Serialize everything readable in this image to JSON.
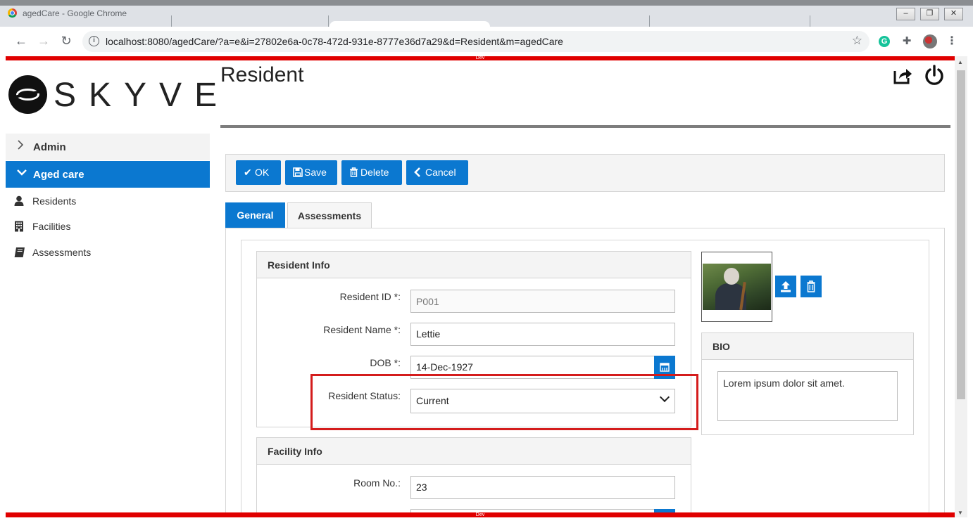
{
  "browser": {
    "window_title": "agedCare - Google Chrome",
    "url": "localhost:8080/agedCare/?a=e&i=27802e6a-0c78-472d-931e-8777e36d7a29&d=Resident&m=agedCare",
    "env_banner": "Dev",
    "window_controls": {
      "minimize": "–",
      "restore": "❐",
      "close": "✕"
    },
    "extension_letter": "G"
  },
  "sidebar": {
    "logo_text": "SKYVE",
    "menu": [
      {
        "label": "Admin",
        "expanded": false,
        "icon": "chevron-right-icon"
      },
      {
        "label": "Aged care",
        "expanded": true,
        "icon": "chevron-down-icon"
      }
    ],
    "items": [
      {
        "label": "Residents",
        "icon": "user-icon"
      },
      {
        "label": "Facilities",
        "icon": "building-icon"
      },
      {
        "label": "Assessments",
        "icon": "book-icon"
      }
    ]
  },
  "page": {
    "title": "Resident"
  },
  "toolbar": {
    "ok_label": "OK",
    "save_label": "Save",
    "delete_label": "Delete",
    "cancel_label": "Cancel"
  },
  "tabs": [
    {
      "label": "General",
      "active": true
    },
    {
      "label": "Assessments",
      "active": false
    }
  ],
  "resident_info": {
    "legend": "Resident Info",
    "fields": {
      "resident_id": {
        "label": "Resident ID *:",
        "placeholder": "P001"
      },
      "resident_name": {
        "label": "Resident Name *:",
        "value": "Lettie"
      },
      "dob": {
        "label": "DOB *:",
        "value": "14-Dec-1927"
      },
      "resident_status": {
        "label": "Resident Status:",
        "value": "Current"
      }
    }
  },
  "facility_info": {
    "legend": "Facility Info",
    "fields": {
      "room_no": {
        "label": "Room No.:",
        "value": "23"
      }
    }
  },
  "bio": {
    "legend": "BIO",
    "value": "Lorem ipsum dolor sit amet."
  },
  "colors": {
    "primary": "#0b78d0",
    "dev_banner": "#e00000",
    "highlight": "#d41c1c"
  }
}
